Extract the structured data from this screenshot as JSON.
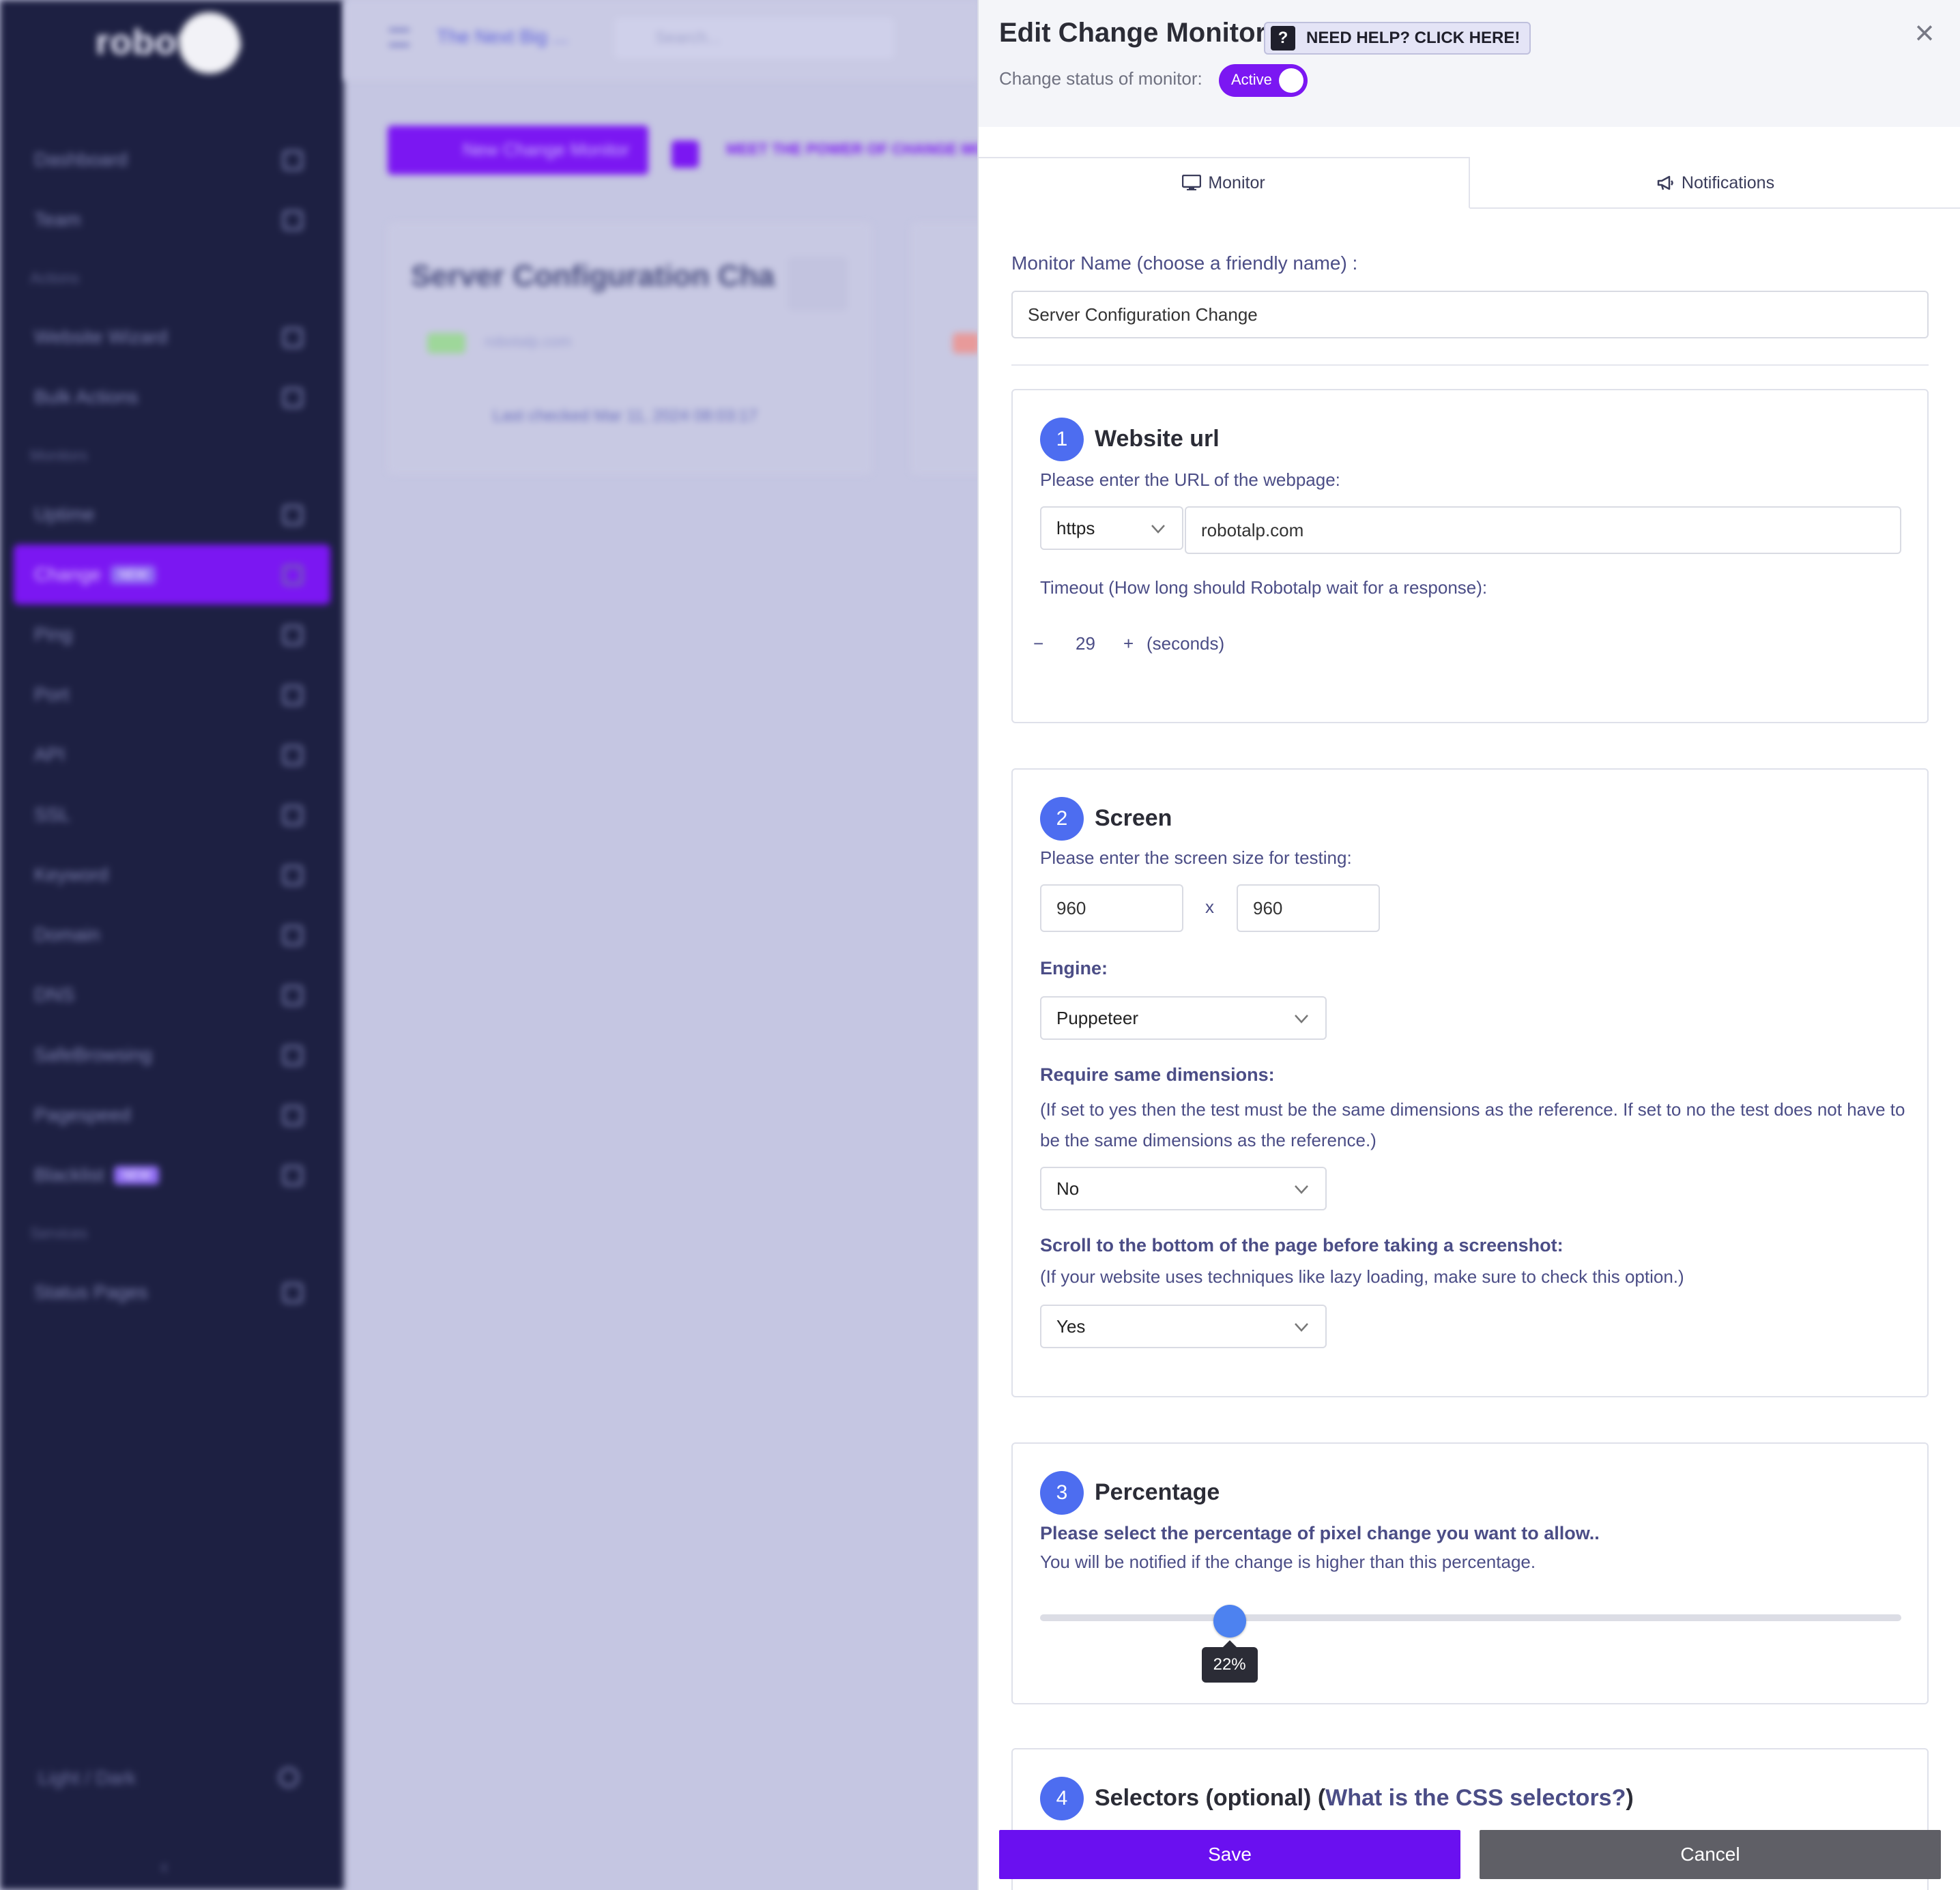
{
  "background": {
    "brand": "robotalp",
    "nav_items": [
      {
        "label": "Dashboard",
        "type": "item"
      },
      {
        "label": "Team",
        "type": "item"
      },
      {
        "label": "Actions",
        "type": "section"
      },
      {
        "label": "Website Wizard",
        "type": "item"
      },
      {
        "label": "Bulk Actions",
        "type": "item"
      },
      {
        "label": "Monitors",
        "type": "section"
      },
      {
        "label": "Uptime",
        "type": "item"
      },
      {
        "label": "Change",
        "type": "active",
        "badge": "NEW"
      },
      {
        "label": "Ping",
        "type": "item"
      },
      {
        "label": "Port",
        "type": "item"
      },
      {
        "label": "API",
        "type": "item"
      },
      {
        "label": "SSL",
        "type": "item"
      },
      {
        "label": "Keyword",
        "type": "item"
      },
      {
        "label": "Domain",
        "type": "item"
      },
      {
        "label": "DNS",
        "type": "item"
      },
      {
        "label": "SafeBrowsing",
        "type": "item"
      },
      {
        "label": "Pagespeed",
        "type": "item"
      },
      {
        "label": "Blacklist",
        "type": "item",
        "badge": "NEW"
      },
      {
        "label": "Services",
        "type": "section"
      },
      {
        "label": "Status Pages",
        "type": "item"
      }
    ],
    "light_dark": "Light / Dark",
    "team_select": "The Next Big ...",
    "search_placeholder": "Search...",
    "new_monitor_button": "New Change Monitor",
    "promo_text": "MEET THE POWER OF CHANGE MONITORING",
    "card_title": "Server Configuration Cha",
    "card_url": "robotalp.com",
    "card_last_checked": "Last checked Mar 11, 2024 08:03:17"
  },
  "drawer": {
    "title": "Edit Change Monitor",
    "help_label": "NEED HELP? CLICK HERE!",
    "close_label": "×",
    "status_label": "Change status of monitor:",
    "status_toggle": "Active",
    "tabs": [
      {
        "label": "Monitor",
        "icon": "monitor-icon"
      },
      {
        "label": "Notifications",
        "icon": "megaphone-icon"
      }
    ],
    "monitor_name_label": "Monitor Name (choose a friendly name) :",
    "monitor_name_value": "Server Configuration Change",
    "step1": {
      "num": "1",
      "title": "Website url",
      "url_label": "Please enter the URL of the webpage:",
      "protocol": "https",
      "url_value": "robotalp.com",
      "timeout_label": "Timeout (How long should Robotalp wait for a response):",
      "timeout_minus": "−",
      "timeout_value": "29",
      "timeout_plus": "+",
      "timeout_unit": "(seconds)"
    },
    "step2": {
      "num": "2",
      "title": "Screen",
      "size_label": "Please enter the screen size for testing:",
      "width": "960",
      "x": "x",
      "height": "960",
      "engine_label": "Engine:",
      "engine_value": "Puppeteer",
      "same_dim_label": "Require same dimensions:",
      "same_dim_help": "(If set to yes then the test must be the same dimensions as the reference. If set to no the test does not have to be the same dimensions as the reference.)",
      "same_dim_value": "No",
      "scroll_label": "Scroll to the bottom of the page before taking a screenshot:",
      "scroll_help": "(If your website uses techniques like lazy loading, make sure to check this option.)",
      "scroll_value": "Yes"
    },
    "step3": {
      "num": "3",
      "title": "Percentage",
      "help_bold": "Please select the percentage of pixel change you want to allow..",
      "help_text": "You will be notified if the change is higher than this percentage.",
      "slider_value": 22,
      "slider_label": "22%"
    },
    "step4": {
      "num": "4",
      "title_prefix": "Selectors (optional) (",
      "title_link": "What is the CSS selectors?",
      "title_suffix": ")"
    },
    "save_label": "Save",
    "cancel_label": "Cancel"
  },
  "colors": {
    "accent": "#7b17f2",
    "step_circle": "#4d6df0",
    "label_text": "#4b4d86",
    "cancel": "#5f5f66"
  }
}
